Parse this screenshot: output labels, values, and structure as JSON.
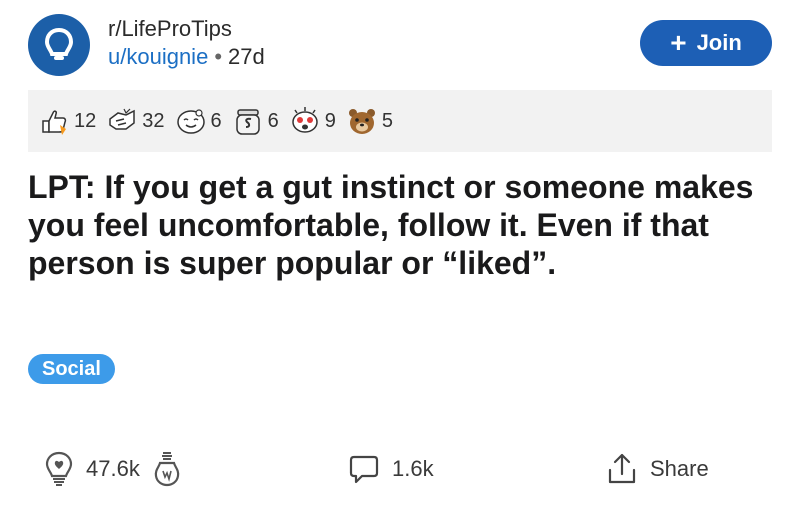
{
  "post": {
    "subreddit": "r/LifeProTips",
    "author": "u/kouignie",
    "separator": "•",
    "age": "27d",
    "join_label": "Join",
    "title": "LPT: If you get a gut instinct or someone makes you feel uncomfortable, follow it. Even if that person is super popular or “liked”.",
    "flair": "Social"
  },
  "awards": [
    {
      "icon": "thumbs-up-award-icon",
      "count": "12"
    },
    {
      "icon": "helpful-hands-award-icon",
      "count": "32"
    },
    {
      "icon": "wholesome-face-award-icon",
      "count": "6"
    },
    {
      "icon": "silver-jar-award-icon",
      "count": "6"
    },
    {
      "icon": "starstruck-award-icon",
      "count": "9"
    },
    {
      "icon": "bear-award-icon",
      "count": "5"
    }
  ],
  "actions": {
    "votes": "47.6k",
    "comments": "1.6k",
    "share_label": "Share"
  },
  "colors": {
    "accent": "#1d5fb5",
    "subreddit_icon_bg": "#1c5fa8",
    "flair_bg": "#3d9be9",
    "link": "#1c6fc4",
    "awards_bg": "#f2f2f2"
  }
}
